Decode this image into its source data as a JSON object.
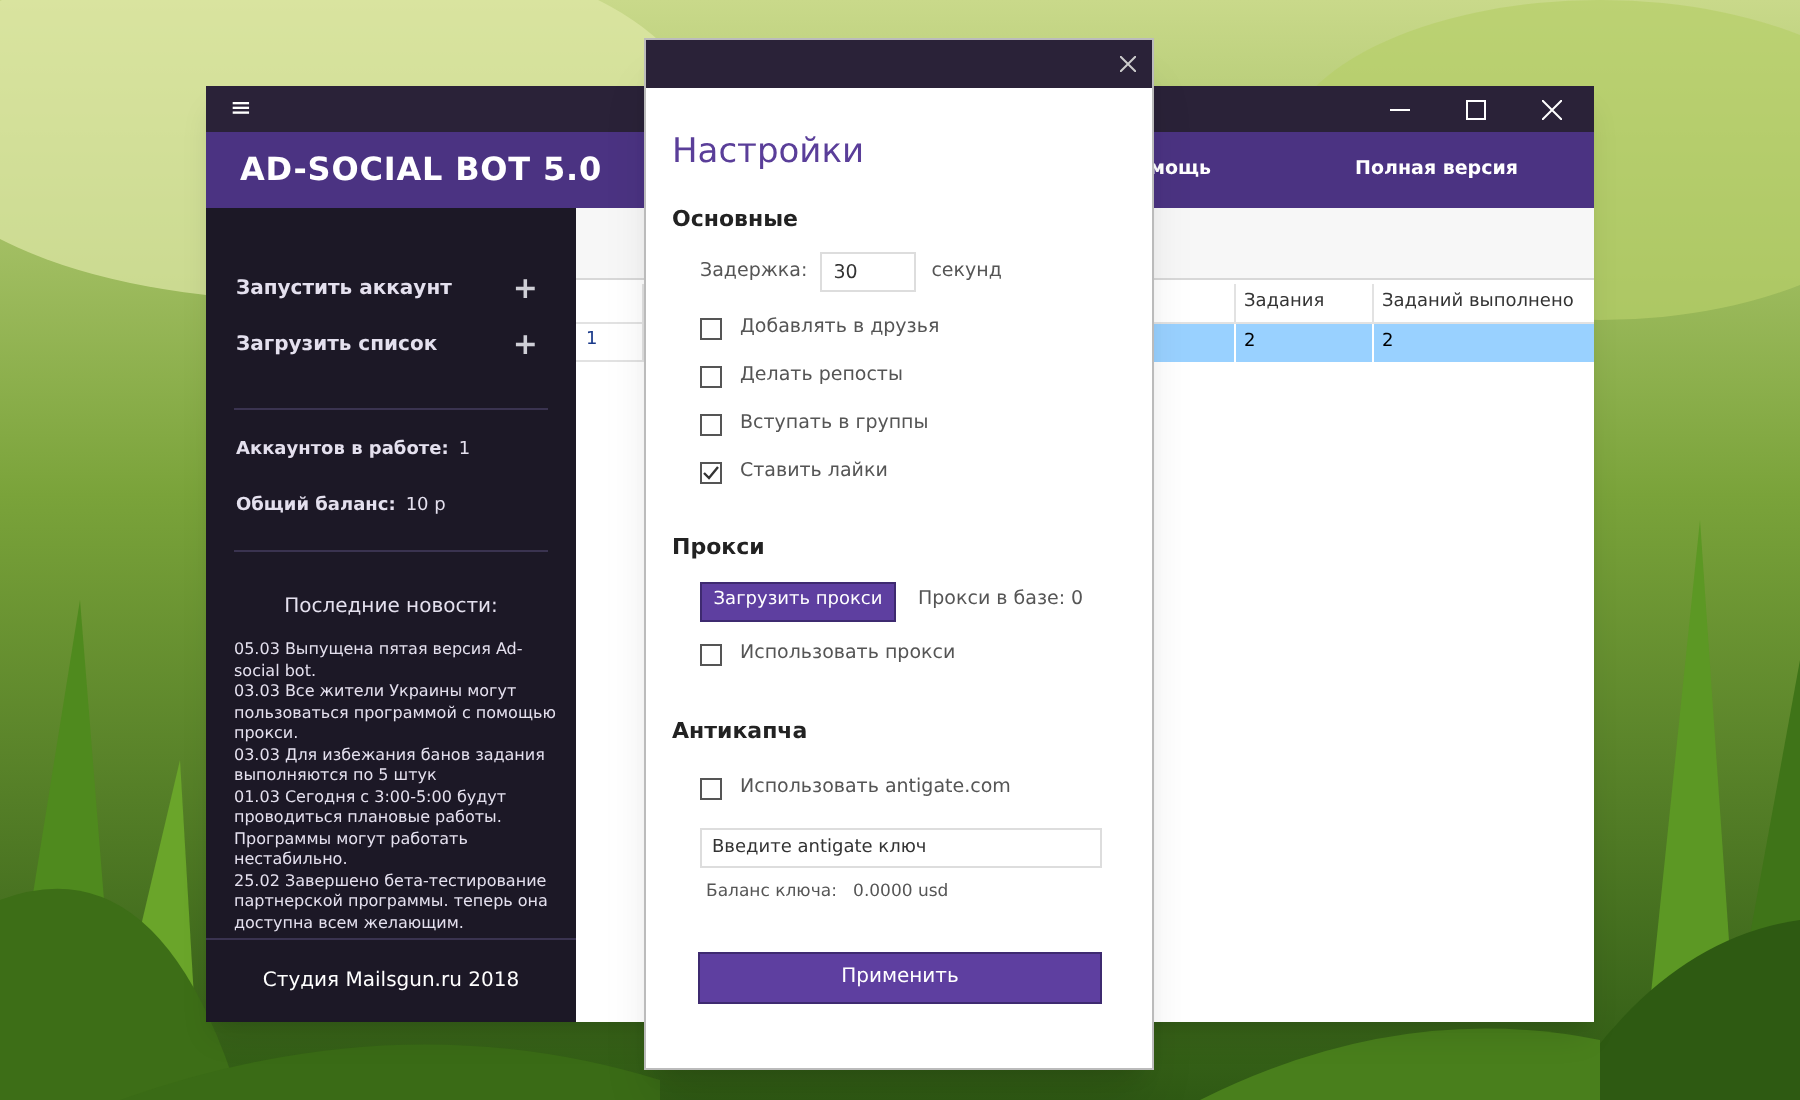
{
  "app": {
    "title": "AD-SOCIAL BOT 5.0",
    "menu_icon": "≡",
    "header_menu": [
      "мощь",
      "Полная версия"
    ],
    "sidebar": {
      "actions": [
        {
          "label": "Запустить аккаунт",
          "icon": "+"
        },
        {
          "label": "Загрузить список",
          "icon": "+"
        }
      ],
      "stats": [
        {
          "label": "Аккаунтов в работе:",
          "value": "1"
        },
        {
          "label": "Общий баланс:",
          "value": "10 р"
        }
      ],
      "news_title": "Последние новости:",
      "news": "05.03 Выпущена пятая версия Ad-social bot.\n03.03 Все жители Украины могут пользоваться программой с помощью прокси.\n03.03 Для избежания банов задания выполняются по 5 штук\n01.03 Сегодня с 3:00-5:00 будут проводиться плановые работы. Программы могут работать нестабильно.\n25.02 Завершено бета-тестирование партнерской программы. теперь она доступна всем желающим.",
      "footer": "Студия Mailsgun.ru 2018"
    },
    "table": {
      "columns": [
        "Задания",
        "Заданий выполнено"
      ],
      "rows": [
        {
          "row_number": "1",
          "cells": [
            "2",
            "2"
          ],
          "selected": true
        }
      ]
    }
  },
  "dialog": {
    "title": "Настройки",
    "sections": [
      {
        "heading": "Основные",
        "delay": {
          "label": "Задержка:",
          "value": "30",
          "unit": "секунд"
        },
        "checkboxes": [
          {
            "label": "Добавлять в друзья",
            "checked": false
          },
          {
            "label": "Делать репосты",
            "checked": false
          },
          {
            "label": "Вступать в группы",
            "checked": false
          },
          {
            "label": "Ставить лайки",
            "checked": true
          }
        ]
      },
      {
        "heading": "Прокси",
        "button": "Загрузить прокси",
        "info": "Прокси в базе:  0",
        "checkboxes": [
          {
            "label": "Использовать прокси",
            "checked": false
          }
        ]
      },
      {
        "heading": "Антикапча",
        "checkboxes": [
          {
            "label": "Использовать antigate.com",
            "checked": false
          }
        ],
        "key_field": {
          "placeholder": "Введите antigate ключ"
        },
        "info": "Баланс ключа:   0.0000 usd"
      }
    ],
    "apply": "Применить"
  }
}
